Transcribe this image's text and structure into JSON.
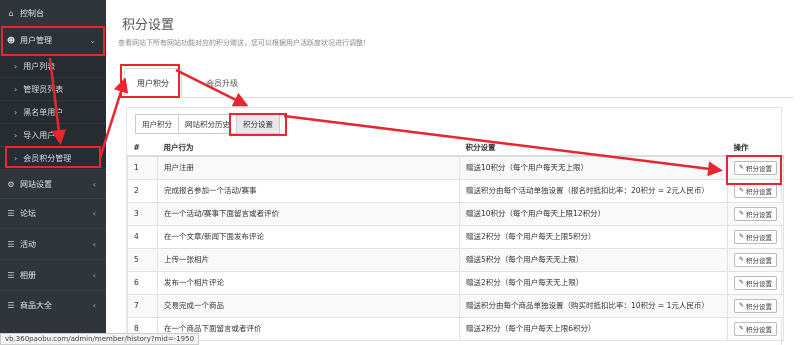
{
  "sidebar": {
    "items": [
      {
        "label": "控制台",
        "icon": "home-icon"
      },
      {
        "label": "用户管理",
        "icon": "users-icon"
      },
      {
        "label": "网站设置",
        "icon": "gear-icon"
      },
      {
        "label": "论坛",
        "icon": "list-icon"
      },
      {
        "label": "活动",
        "icon": "list-icon"
      },
      {
        "label": "相册",
        "icon": "list-icon"
      },
      {
        "label": "商品大全",
        "icon": "list-icon"
      }
    ],
    "sub_items": [
      {
        "label": "用户列表"
      },
      {
        "label": "管理员列表"
      },
      {
        "label": "黑名单用户"
      },
      {
        "label": "导入用户"
      },
      {
        "label": "会员积分管理"
      }
    ]
  },
  "main": {
    "title": "积分设置",
    "subtitle": "查看网站下所有网站功能对应的积分赠送，您可以根据用户活跃度状况进行调整！",
    "tabs": [
      {
        "label": "用户积分"
      },
      {
        "label": "会员升级"
      }
    ],
    "subtabs": [
      {
        "label": "用户积分"
      },
      {
        "label": "网站积分历史"
      },
      {
        "label": "积分设置"
      }
    ]
  },
  "table": {
    "headers": [
      "#",
      "用户行为",
      "积分设置",
      "操作"
    ],
    "button_label": "积分设置",
    "rows": [
      {
        "num": "1",
        "action": "用户注册",
        "setting": "赠送10积分（每个用户每天无上限）"
      },
      {
        "num": "2",
        "action": "完成报名参加一个活动/赛事",
        "setting": "赠送积分由每个活动单独设置（报名时抵扣比率：20积分 = 2元人民币）"
      },
      {
        "num": "3",
        "action": "在一个活动/赛事下面留言或者评价",
        "setting": "赠送10积分（每个用户每天上限12积分）"
      },
      {
        "num": "4",
        "action": "在一个文章/新闻下面发布评论",
        "setting": "赠送2积分（每个用户每天上限5积分）"
      },
      {
        "num": "5",
        "action": "上传一张相片",
        "setting": "赠送5积分（每个用户每天无上限）"
      },
      {
        "num": "6",
        "action": "发布一个相片评论",
        "setting": "赠送2积分（每个用户每天无上限）"
      },
      {
        "num": "7",
        "action": "交易完成一个商品",
        "setting": "赠送积分由每个商品单独设置（购买时抵扣比率：10积分 = 1元人民币）"
      },
      {
        "num": "8",
        "action": "在一个商品下面留言或者评价",
        "setting": "赠送2积分（每个用户每天上限6积分）"
      }
    ]
  },
  "statusbar": {
    "text": "vb.360paobu.com/admin/member/history?mid=-1950"
  },
  "colors": {
    "sidebar_bg": "#2f353b",
    "annotation": "#e8262f"
  }
}
